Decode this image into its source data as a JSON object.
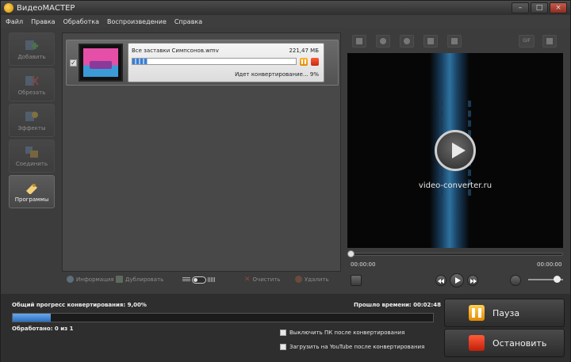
{
  "window": {
    "title": "ВидеоМАСТЕР",
    "buttons": {
      "minimize": "–",
      "maximize": "□",
      "close": "×"
    }
  },
  "menu": [
    "Файл",
    "Правка",
    "Обработка",
    "Воспроизведение",
    "Справка"
  ],
  "sidebar": [
    {
      "label": "Добавить",
      "icon": "add-icon",
      "active": false
    },
    {
      "label": "Обрезать",
      "icon": "cut-icon",
      "active": false
    },
    {
      "label": "Эффекты",
      "icon": "effects-icon",
      "active": false
    },
    {
      "label": "Соединить",
      "icon": "join-icon",
      "active": false
    },
    {
      "label": "Программы",
      "icon": "programs-icon",
      "active": true
    }
  ],
  "file": {
    "checked": true,
    "name": "Все заставки Симпсонов.wmv",
    "size": "221,47 МБ",
    "progress": 0.09,
    "status": "Идет конвертирование... 9%"
  },
  "list_toolbar": {
    "info": "Информация",
    "duplicate": "Дублировать",
    "clear": "Очистить",
    "delete": "Удалить"
  },
  "preview": {
    "caption": "video-converter.ru",
    "time_current": "00:00:00",
    "time_total": "00:00:00",
    "gif_label": "GIF",
    "seek": 0.0,
    "volume": 0.8
  },
  "bottom": {
    "overall_label": "Общий прогресс конвертирования: 9,00%",
    "overall_progress": 0.09,
    "elapsed": "Прошло времени: 00:02:48",
    "processed": "Обработано: 0 из 1",
    "options": [
      {
        "label": "Выключить ПК после конвертирования",
        "checked": false
      },
      {
        "label": "Загрузить на YouTube после конвертирования",
        "checked": false
      }
    ],
    "pause_label": "Пауза",
    "stop_label": "Остановить"
  },
  "colors": {
    "accent_pause": "#f0a000",
    "accent_stop": "#e03010",
    "progress_blue": "#3b7ed2"
  }
}
